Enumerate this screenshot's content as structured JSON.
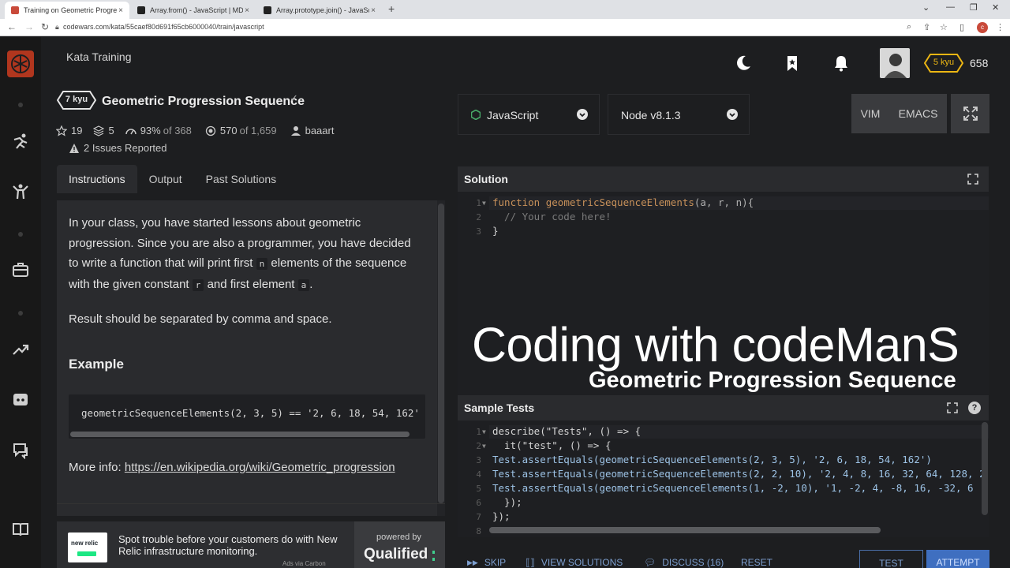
{
  "browser": {
    "tabs": [
      {
        "label": "Training on Geometric Progressio...",
        "active": true
      },
      {
        "label": "Array.from() - JavaScript | MDN",
        "active": false
      },
      {
        "label": "Array.prototype.join() - JavaScri...",
        "active": false
      }
    ],
    "url": "codewars.com/kata/55caef80d691f65cb6000040/train/javascript"
  },
  "header": {
    "section_title": "Kata Training",
    "rank_badge": "5 kyu",
    "honor": "658"
  },
  "kata": {
    "rank": "7 kyu",
    "title": "Geometric Progression Sequence",
    "stats": {
      "stars": "19",
      "collections": "5",
      "satisfaction": "93%",
      "satisfaction_of": "of 368",
      "completed": "570",
      "completed_of": "of 1,659",
      "author": "baaart"
    },
    "issues": "2 Issues Reported"
  },
  "left_tabs": [
    "Instructions",
    "Output",
    "Past Solutions"
  ],
  "instructions": {
    "p1_a": "In your class, you have started lessons about geometric progression. Since you are also a programmer, you have decided to write a function that will print first",
    "code_n": "n",
    "p1_b": "elements of the sequence with the given constant",
    "code_r": "r",
    "p1_c": "and first element",
    "code_a": "a",
    "p1_d": ".",
    "p2": "Result should be separated by comma and space.",
    "example_heading": "Example",
    "example_code": "geometricSequenceElements(2, 3, 5) == '2, 6, 18, 54, 162'",
    "more_info_label": "More info:",
    "more_info_link": "https://en.wikipedia.org/wiki/Geometric_progression"
  },
  "ad": {
    "logo_text": "new relic",
    "text": "Spot trouble before your customers do with New Relic infrastructure monitoring.",
    "via": "Ads via Carbon",
    "powered_by": "powered by",
    "brand": "Qualified"
  },
  "toolbar": {
    "language": "JavaScript",
    "runtime": "Node v8.1.3",
    "vim": "VIM",
    "emacs": "EMACS"
  },
  "solution": {
    "title": "Solution",
    "line1_kw": "function",
    "line1_fn": "geometricSequenceElements",
    "line1_rest": "(a, r, n){",
    "line2": "  // Your code here!",
    "line3": "}"
  },
  "overlay": {
    "line1": "Coding with codeManS",
    "line2": "Geometric Progression Sequence"
  },
  "sample_tests": {
    "title": "Sample Tests",
    "lines": [
      "describe(\"Tests\", () => {",
      "  it(\"test\", () => {",
      "Test.assertEquals(geometricSequenceElements(2, 3, 5), '2, 6, 18, 54, 162')",
      "Test.assertEquals(geometricSequenceElements(2, 2, 10), '2, 4, 8, 16, 32, 64, 128, 2",
      "Test.assertEquals(geometricSequenceElements(1, -2, 10), '1, -2, 4, -8, 16, -32, 6",
      "  });",
      "});",
      ""
    ]
  },
  "actions": {
    "skip": "SKIP",
    "view_solutions": "VIEW SOLUTIONS",
    "discuss": "DISCUSS (16)",
    "reset": "RESET",
    "test": "TEST",
    "attempt": "ATTEMPT"
  }
}
